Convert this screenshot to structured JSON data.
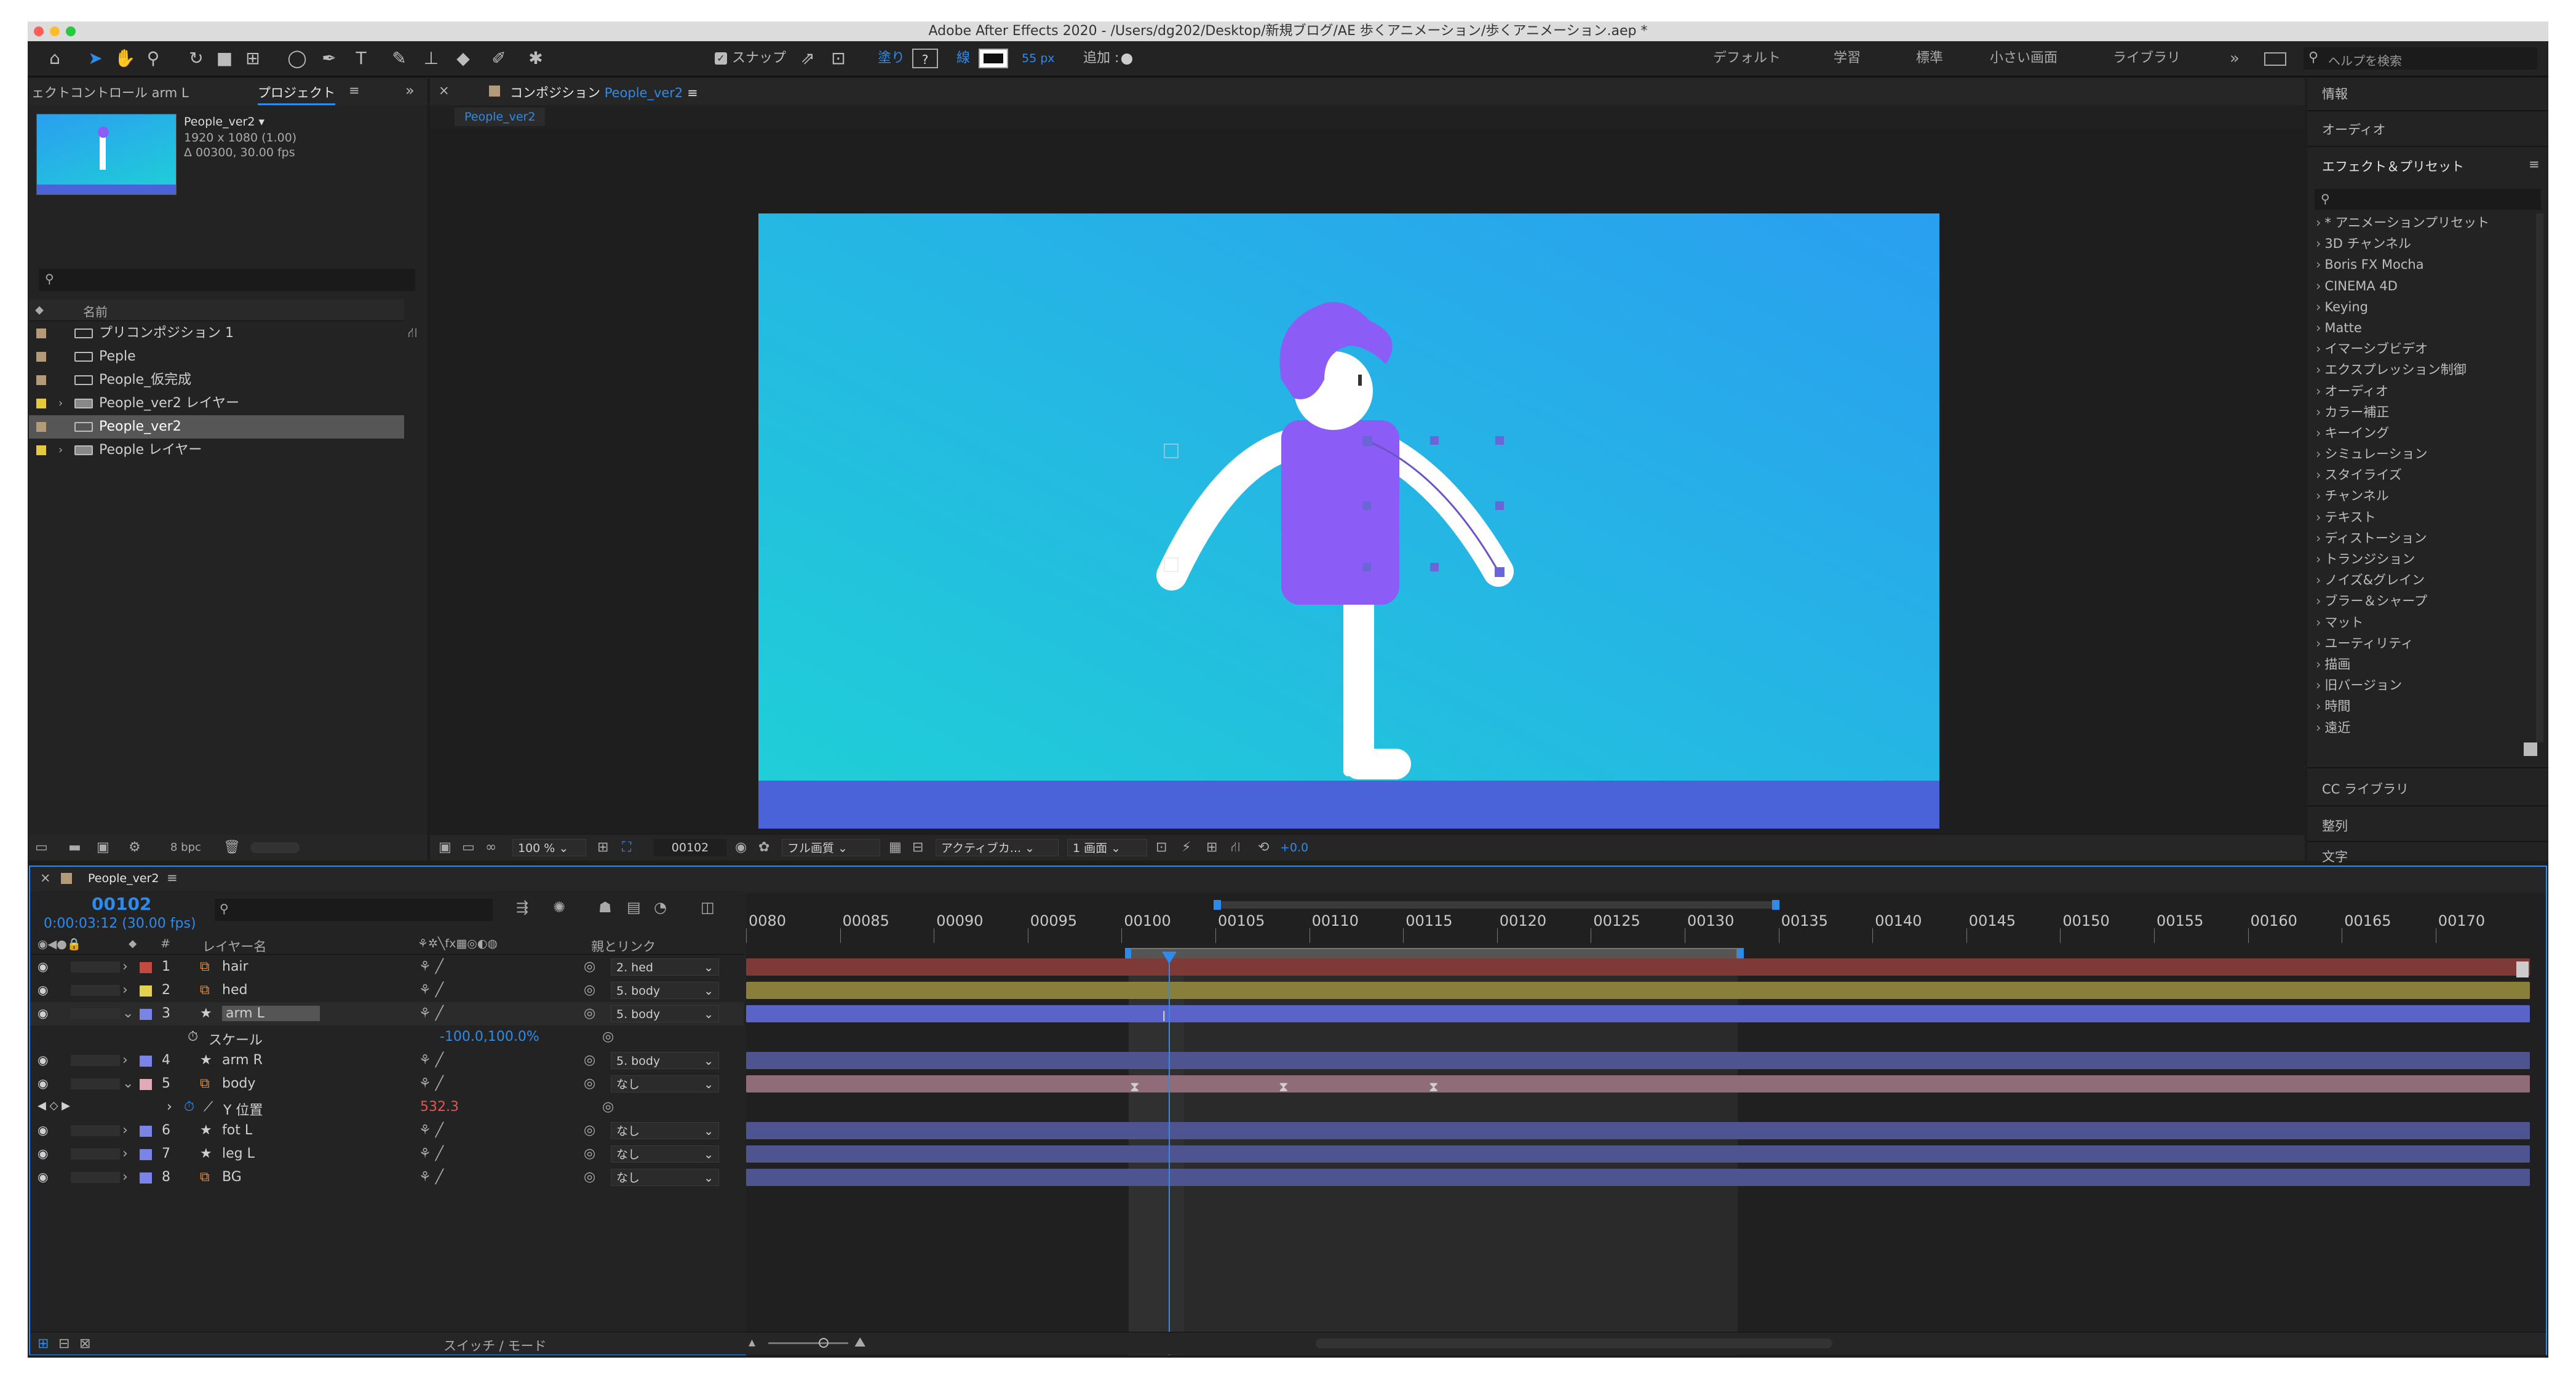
{
  "window": {
    "title": "Adobe After Effects 2020 - /Users/dg202/Desktop/新規ブログ/AE 歩くアニメーション/歩くアニメーション.aep *"
  },
  "toolbar": {
    "snap_label": "スナップ",
    "fill_label": "塗り",
    "fill_value": "?",
    "stroke_label": "線",
    "stroke_width": "55 px",
    "add_label": "追加 :",
    "workspaces": [
      "デフォルト",
      "学習",
      "標準",
      "小さい画面",
      "ライブラリ"
    ],
    "more": "»",
    "search_placeholder": "ヘルプを検索"
  },
  "left_panel": {
    "tab_effects": "ェクトコントロール arm L",
    "tab_project": "プロジェクト",
    "menu": "≡",
    "expand": "»",
    "comp_name": "People_ver2 ▾",
    "comp_res": "1920 x 1080 (1.00)",
    "comp_dur": "Δ 00300, 30.00 fps",
    "col_name": "名前",
    "items": [
      {
        "name": "プリコンポジション 1",
        "type": "comp",
        "color": "#b39b7a"
      },
      {
        "name": "Peple",
        "type": "comp",
        "color": "#b39b7a"
      },
      {
        "name": "People_仮完成",
        "type": "comp",
        "color": "#b39b7a"
      },
      {
        "name": "People_ver2 レイヤー",
        "type": "folder",
        "color": "#e3c93b"
      },
      {
        "name": "People_ver2",
        "type": "comp",
        "color": "#b39b7a"
      },
      {
        "name": "People レイヤー",
        "type": "folder",
        "color": "#e3c93b"
      }
    ],
    "bpc": "8 bpc"
  },
  "comp_panel": {
    "tab_prefix": "コンポジション",
    "tab_name": "People_ver2",
    "menu": "≡",
    "subtab": "People_ver2",
    "zoom": "100 %",
    "frame": "00102",
    "quality": "フル画質",
    "camera": "アクティブカ...",
    "views": "1 画面",
    "exposure": "+0.0"
  },
  "right_panel": {
    "info": "情報",
    "audio": "オーディオ",
    "effects_title": "エフェクト＆プリセット",
    "menu": "≡",
    "effects": [
      "* アニメーションプリセット",
      "3D チャンネル",
      "Boris FX Mocha",
      "CINEMA 4D",
      "Keying",
      "Matte",
      "イマーシブビデオ",
      "エクスプレッション制御",
      "オーディオ",
      "カラー補正",
      "キーイング",
      "シミュレーション",
      "スタイライズ",
      "チャンネル",
      "テキスト",
      "ディストーション",
      "トランジション",
      "ノイズ&グレイン",
      "ブラー＆シャープ",
      "マット",
      "ユーティリティ",
      "描画",
      "旧バージョン",
      "時間",
      "遠近"
    ],
    "cc_library": "CC ライブラリ",
    "align": "整列",
    "text": "文字"
  },
  "timeline": {
    "tab": "People_ver2",
    "menu": "≡",
    "current_frame": "00102",
    "timecode": "0:00:03:12 (30.00 fps)",
    "col_layer_name": "レイヤー名",
    "col_parent": "親とリンク",
    "col_number": "#",
    "ticks": [
      "0080",
      "00085",
      "00090",
      "00095",
      "00100",
      "00105",
      "00110",
      "00115",
      "00120",
      "00125",
      "00130",
      "00135",
      "00140",
      "00145",
      "00150",
      "00155",
      "00160",
      "00165",
      "00170"
    ],
    "layers": [
      {
        "num": "1",
        "name": "hair",
        "parent": "2. hed",
        "color": "#c24a3f",
        "bar": "#7d3a37",
        "icon": "comp"
      },
      {
        "num": "2",
        "name": "hed",
        "parent": "5. body",
        "color": "#e3d24d",
        "bar": "#8a7f3a",
        "icon": "comp"
      },
      {
        "num": "3",
        "name": "arm L",
        "parent": "5. body",
        "color": "#7a83e6",
        "bar": "#5a63c8",
        "icon": "star",
        "selected": true
      },
      {
        "num": "4",
        "name": "arm R",
        "parent": "5. body",
        "color": "#7a83e6",
        "bar": "#4e548f",
        "icon": "star"
      },
      {
        "num": "5",
        "name": "body",
        "parent": "なし",
        "color": "#e2a9b8",
        "bar": "#8f6c78",
        "icon": "comp"
      },
      {
        "num": "6",
        "name": "fot L",
        "parent": "なし",
        "color": "#7a83e6",
        "bar": "#4e548f",
        "icon": "star"
      },
      {
        "num": "7",
        "name": "leg L",
        "parent": "なし",
        "color": "#7a83e6",
        "bar": "#4e548f",
        "icon": "star"
      },
      {
        "num": "8",
        "name": "BG",
        "parent": "なし",
        "color": "#7a83e6",
        "bar": "#4e548f",
        "icon": "comp"
      }
    ],
    "prop_scale_label": "スケール",
    "prop_scale_value": "-100.0,100.0%",
    "prop_ypos_label": "Y 位置",
    "prop_ypos_value": "532.3",
    "switch_mode": "スイッチ / モード"
  },
  "colors": {
    "accent": "#2d8ceb",
    "sky_top": "#2a9ff0",
    "sky_bottom": "#1fd0d6",
    "ground": "#4a63d8",
    "purple": "#8b5cf6"
  }
}
